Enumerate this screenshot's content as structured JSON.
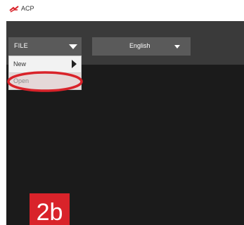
{
  "window": {
    "title": "ACP"
  },
  "toolbar": {
    "file_label": "FILE",
    "language_label": "English"
  },
  "file_menu": {
    "items": [
      {
        "label": "New"
      },
      {
        "label": "Open"
      }
    ]
  },
  "annotation": {
    "step_label": "2b",
    "badge_color": "#d9232a",
    "highlight_color": "#d9232a"
  },
  "colors": {
    "app_background": "#1b1b1b",
    "toolbar_background": "#3a3a3a",
    "select_background": "#5a5a5a",
    "menu_background": "#f2f2f2"
  },
  "icons": {
    "logo": "acp-logo-icon",
    "file_dropdown": "chevron-down-icon",
    "language_dropdown": "chevron-down-icon",
    "submenu": "chevron-right-icon"
  }
}
